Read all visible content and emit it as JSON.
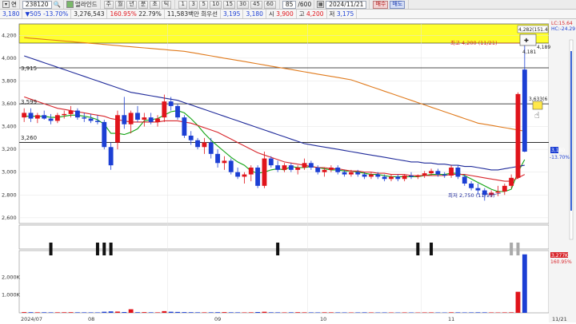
{
  "toolbar": {
    "row1": {
      "mode_label": "연",
      "stock_code": "238120",
      "stock_name": "얼라인드",
      "buttons": [
        "주",
        "월",
        "년",
        "분",
        "초",
        "틱"
      ],
      "period_buttons": [
        "1",
        "3",
        "5",
        "10",
        "15",
        "30",
        "45",
        "60"
      ],
      "range_value": "85",
      "range_total": "/600",
      "date_value": "2024/11/21",
      "buy_label": "매수",
      "sell_label": "매도"
    },
    "row2": {
      "price": "3,180",
      "change": "505",
      "change_pct": "-13.70%",
      "volume": "3,276,543",
      "vol_ratio": "160.95%",
      "turnover_pct": "22.79%",
      "amount_label": "11,583백만",
      "pref_label": "희우선",
      "pref_price": "3,195",
      "start_label": "3,180",
      "open_label": "시",
      "open_value": "3,900",
      "high_label": "고",
      "high_value": "4,200",
      "low_label": "저",
      "low_value": "3,175"
    }
  },
  "price_axis": {
    "ticks": [
      "4,200",
      "4,000",
      "3,800",
      "3,600",
      "3,400",
      "3,200",
      "3,000",
      "2,800",
      "2,600"
    ],
    "right_labels": {
      "current_price": "3,180",
      "current_pct": "-13.70%",
      "lc": "LC:15.64",
      "hc": "HC:-24.29"
    }
  },
  "volume_axis": {
    "ticks": [
      "2,000K",
      "1,000K"
    ],
    "current_volume": "3,277K",
    "current_pct": "160.95%"
  },
  "x_axis": {
    "labels": [
      "2024/07",
      "08",
      "09",
      "10",
      "11",
      "11/21"
    ]
  },
  "chart_annotations": {
    "line_labels": [
      "3,915",
      "3,599",
      "3,260"
    ],
    "high_annotation": "최고 4,200 (11/21)",
    "low_annotation": "최저 2,750 (11/15)",
    "box_high": "4,282(151.4",
    "box_4189": "4,189",
    "box_4181": "4,181",
    "box_3633": "3,633(6"
  },
  "chart_data": {
    "type": "candlestick",
    "ylim": [
      2550,
      4300
    ],
    "candles": [
      {
        "o": 3480,
        "h": 3560,
        "l": 3440,
        "c": 3520
      },
      {
        "o": 3520,
        "h": 3560,
        "l": 3440,
        "c": 3470
      },
      {
        "o": 3470,
        "h": 3520,
        "l": 3430,
        "c": 3500
      },
      {
        "o": 3500,
        "h": 3540,
        "l": 3460,
        "c": 3470
      },
      {
        "o": 3470,
        "h": 3510,
        "l": 3420,
        "c": 3450
      },
      {
        "o": 3450,
        "h": 3520,
        "l": 3430,
        "c": 3500
      },
      {
        "o": 3500,
        "h": 3540,
        "l": 3470,
        "c": 3510
      },
      {
        "o": 3510,
        "h": 3580,
        "l": 3480,
        "c": 3540
      },
      {
        "o": 3540,
        "h": 3560,
        "l": 3460,
        "c": 3480
      },
      {
        "o": 3480,
        "h": 3520,
        "l": 3440,
        "c": 3470
      },
      {
        "o": 3470,
        "h": 3510,
        "l": 3430,
        "c": 3450
      },
      {
        "o": 3450,
        "h": 3500,
        "l": 3420,
        "c": 3440
      },
      {
        "o": 3440,
        "h": 3460,
        "l": 3200,
        "c": 3220
      },
      {
        "o": 3220,
        "h": 3260,
        "l": 3020,
        "c": 3060
      },
      {
        "o": 3260,
        "h": 3540,
        "l": 3200,
        "c": 3500
      },
      {
        "o": 3500,
        "h": 3660,
        "l": 3380,
        "c": 3420
      },
      {
        "o": 3420,
        "h": 3540,
        "l": 3340,
        "c": 3520
      },
      {
        "o": 3520,
        "h": 3580,
        "l": 3440,
        "c": 3460
      },
      {
        "o": 3460,
        "h": 3520,
        "l": 3400,
        "c": 3480
      },
      {
        "o": 3480,
        "h": 3520,
        "l": 3420,
        "c": 3440
      },
      {
        "o": 3440,
        "h": 3500,
        "l": 3400,
        "c": 3470
      },
      {
        "o": 3480,
        "h": 3680,
        "l": 3440,
        "c": 3620
      },
      {
        "o": 3620,
        "h": 3660,
        "l": 3540,
        "c": 3580
      },
      {
        "o": 3580,
        "h": 3600,
        "l": 3460,
        "c": 3480
      },
      {
        "o": 3480,
        "h": 3500,
        "l": 3300,
        "c": 3320
      },
      {
        "o": 3320,
        "h": 3360,
        "l": 3240,
        "c": 3280
      },
      {
        "o": 3280,
        "h": 3300,
        "l": 3200,
        "c": 3220
      },
      {
        "o": 3220,
        "h": 3300,
        "l": 3160,
        "c": 3260
      },
      {
        "o": 3260,
        "h": 3300,
        "l": 3120,
        "c": 3160
      },
      {
        "o": 3160,
        "h": 3200,
        "l": 3040,
        "c": 3080
      },
      {
        "o": 3080,
        "h": 3140,
        "l": 3020,
        "c": 3100
      },
      {
        "o": 3100,
        "h": 3120,
        "l": 2980,
        "c": 3000
      },
      {
        "o": 3000,
        "h": 3040,
        "l": 2940,
        "c": 2960
      },
      {
        "o": 2960,
        "h": 3000,
        "l": 2900,
        "c": 2980
      },
      {
        "o": 2980,
        "h": 3060,
        "l": 2920,
        "c": 3040
      },
      {
        "o": 3040,
        "h": 3060,
        "l": 2860,
        "c": 2880
      },
      {
        "o": 2880,
        "h": 3180,
        "l": 2860,
        "c": 3120
      },
      {
        "o": 3120,
        "h": 3140,
        "l": 3040,
        "c": 3060
      },
      {
        "o": 3060,
        "h": 3100,
        "l": 3000,
        "c": 3020
      },
      {
        "o": 3020,
        "h": 3080,
        "l": 3000,
        "c": 3060
      },
      {
        "o": 3060,
        "h": 3080,
        "l": 3000,
        "c": 3020
      },
      {
        "o": 3020,
        "h": 3060,
        "l": 2980,
        "c": 3040
      },
      {
        "o": 3040,
        "h": 3120,
        "l": 3020,
        "c": 3080
      },
      {
        "o": 3080,
        "h": 3100,
        "l": 3020,
        "c": 3040
      },
      {
        "o": 3040,
        "h": 3060,
        "l": 2980,
        "c": 3000
      },
      {
        "o": 3000,
        "h": 3040,
        "l": 2960,
        "c": 3020
      },
      {
        "o": 3020,
        "h": 3060,
        "l": 3000,
        "c": 3040
      },
      {
        "o": 3040,
        "h": 3060,
        "l": 2980,
        "c": 3000
      },
      {
        "o": 3000,
        "h": 3020,
        "l": 2960,
        "c": 2980
      },
      {
        "o": 2980,
        "h": 3020,
        "l": 2960,
        "c": 3000
      },
      {
        "o": 3000,
        "h": 3020,
        "l": 2960,
        "c": 2980
      },
      {
        "o": 2980,
        "h": 3000,
        "l": 2940,
        "c": 2960
      },
      {
        "o": 2960,
        "h": 3000,
        "l": 2940,
        "c": 2980
      },
      {
        "o": 2980,
        "h": 3000,
        "l": 2940,
        "c": 2960
      },
      {
        "o": 2960,
        "h": 2980,
        "l": 2920,
        "c": 2940
      },
      {
        "o": 2940,
        "h": 2980,
        "l": 2920,
        "c": 2960
      },
      {
        "o": 2960,
        "h": 2980,
        "l": 2920,
        "c": 2940
      },
      {
        "o": 2940,
        "h": 2980,
        "l": 2920,
        "c": 2970
      },
      {
        "o": 2970,
        "h": 3000,
        "l": 2940,
        "c": 2960
      },
      {
        "o": 2960,
        "h": 2980,
        "l": 2940,
        "c": 2970
      },
      {
        "o": 2970,
        "h": 3010,
        "l": 2950,
        "c": 2990
      },
      {
        "o": 2990,
        "h": 3030,
        "l": 2970,
        "c": 3010
      },
      {
        "o": 3010,
        "h": 3030,
        "l": 2960,
        "c": 2980
      },
      {
        "o": 2980,
        "h": 3000,
        "l": 2950,
        "c": 2970
      },
      {
        "o": 2970,
        "h": 3060,
        "l": 2950,
        "c": 3040
      },
      {
        "o": 3040,
        "h": 3060,
        "l": 2940,
        "c": 2960
      },
      {
        "o": 2960,
        "h": 2980,
        "l": 2880,
        "c": 2900
      },
      {
        "o": 2900,
        "h": 2920,
        "l": 2840,
        "c": 2860
      },
      {
        "o": 2860,
        "h": 2900,
        "l": 2800,
        "c": 2840
      },
      {
        "o": 2840,
        "h": 2860,
        "l": 2750,
        "c": 2800
      },
      {
        "o": 2800,
        "h": 2840,
        "l": 2780,
        "c": 2820
      },
      {
        "o": 2820,
        "h": 2880,
        "l": 2790,
        "c": 2830
      },
      {
        "o": 2830,
        "h": 2900,
        "l": 2800,
        "c": 2880
      },
      {
        "o": 2880,
        "h": 2980,
        "l": 2860,
        "c": 2950
      },
      {
        "o": 2950,
        "h": 3700,
        "l": 2940,
        "c": 3685
      },
      {
        "o": 3900,
        "h": 4200,
        "l": 3175,
        "c": 3180
      }
    ],
    "ma_lines": [
      {
        "name": "MA5",
        "color": "#12a312",
        "values": [
          3490,
          3490,
          3490,
          3490,
          3480,
          3480,
          3490,
          3500,
          3500,
          3490,
          3480,
          3460,
          3420,
          3340,
          3340,
          3330,
          3350,
          3380,
          3450,
          3460,
          3470,
          3500,
          3530,
          3540,
          3520,
          3470,
          3410,
          3340,
          3280,
          3230,
          3180,
          3130,
          3090,
          3060,
          3010,
          2990,
          3000,
          3020,
          3030,
          3020,
          3050,
          3040,
          3040,
          3050,
          3040,
          3030,
          3020,
          3020,
          3010,
          3010,
          3000,
          2990,
          2980,
          2980,
          2970,
          2960,
          2960,
          2960,
          2960,
          2960,
          2970,
          2980,
          2980,
          2980,
          2990,
          2990,
          2970,
          2940,
          2910,
          2880,
          2850,
          2830,
          2830,
          2850,
          3000,
          3110
        ]
      },
      {
        "name": "MA20",
        "color": "#d8262c",
        "values": [
          3660,
          3640,
          3620,
          3600,
          3580,
          3560,
          3550,
          3540,
          3530,
          3520,
          3510,
          3500,
          3490,
          3470,
          3460,
          3450,
          3440,
          3440,
          3440,
          3440,
          3440,
          3450,
          3450,
          3450,
          3440,
          3430,
          3410,
          3390,
          3370,
          3350,
          3320,
          3290,
          3260,
          3230,
          3200,
          3170,
          3150,
          3130,
          3110,
          3090,
          3080,
          3070,
          3060,
          3050,
          3040,
          3040,
          3030,
          3030,
          3020,
          3010,
          3010,
          3000,
          3000,
          2990,
          2990,
          2980,
          2980,
          2980,
          2970,
          2970,
          2970,
          2970,
          2970,
          2970,
          2980,
          2980,
          2980,
          2970,
          2960,
          2950,
          2940,
          2930,
          2920,
          2920,
          2950,
          2980
        ]
      },
      {
        "name": "MA60",
        "color": "#1f2a9a",
        "values": [
          4020,
          4000,
          3980,
          3960,
          3940,
          3920,
          3900,
          3880,
          3860,
          3840,
          3820,
          3800,
          3780,
          3760,
          3740,
          3720,
          3700,
          3690,
          3680,
          3670,
          3660,
          3650,
          3640,
          3630,
          3610,
          3590,
          3570,
          3550,
          3530,
          3510,
          3490,
          3470,
          3450,
          3430,
          3410,
          3390,
          3370,
          3350,
          3330,
          3310,
          3290,
          3270,
          3250,
          3240,
          3230,
          3220,
          3210,
          3200,
          3190,
          3180,
          3170,
          3160,
          3150,
          3140,
          3130,
          3120,
          3110,
          3100,
          3090,
          3090,
          3080,
          3080,
          3070,
          3070,
          3060,
          3060,
          3050,
          3050,
          3040,
          3030,
          3020,
          3020,
          3030,
          3040,
          3050,
          3060
        ]
      },
      {
        "name": "MA120",
        "color": "#e07a1c",
        "values": [
          4180,
          4175,
          4170,
          4165,
          4160,
          4155,
          4150,
          4145,
          4140,
          4135,
          4130,
          4125,
          4120,
          4115,
          4110,
          4105,
          4100,
          4095,
          4090,
          4085,
          4080,
          4075,
          4070,
          4065,
          4060,
          4050,
          4040,
          4030,
          4020,
          4010,
          4000,
          3990,
          3980,
          3970,
          3960,
          3950,
          3940,
          3930,
          3920,
          3910,
          3900,
          3890,
          3880,
          3870,
          3860,
          3850,
          3840,
          3830,
          3820,
          3810,
          3790,
          3770,
          3750,
          3730,
          3710,
          3690,
          3670,
          3650,
          3630,
          3610,
          3590,
          3570,
          3550,
          3530,
          3510,
          3490,
          3470,
          3450,
          3430,
          3420,
          3410,
          3400,
          3390,
          3380,
          3370,
          3360
        ]
      }
    ],
    "hlines": [
      3915,
      3599,
      3260
    ],
    "volume": [
      40,
      35,
      30,
      32,
      28,
      30,
      33,
      36,
      30,
      28,
      26,
      25,
      60,
      80,
      70,
      45,
      200,
      35,
      40,
      30,
      28,
      95,
      60,
      50,
      40,
      35,
      30,
      28,
      30,
      35,
      40,
      30,
      28,
      25,
      30,
      45,
      60,
      30,
      28,
      25,
      30,
      35,
      28,
      26,
      25,
      30,
      28,
      26,
      24,
      22,
      25,
      28,
      24,
      22,
      24,
      22,
      20,
      24,
      22,
      20,
      24,
      26,
      22,
      20,
      30,
      28,
      24,
      26,
      30,
      28,
      24,
      22,
      26,
      30,
      1180,
      3277
    ],
    "volume_ylim": [
      0,
      3400
    ],
    "signals": [
      4,
      11,
      12,
      13,
      38,
      59,
      61,
      73,
      74
    ]
  }
}
